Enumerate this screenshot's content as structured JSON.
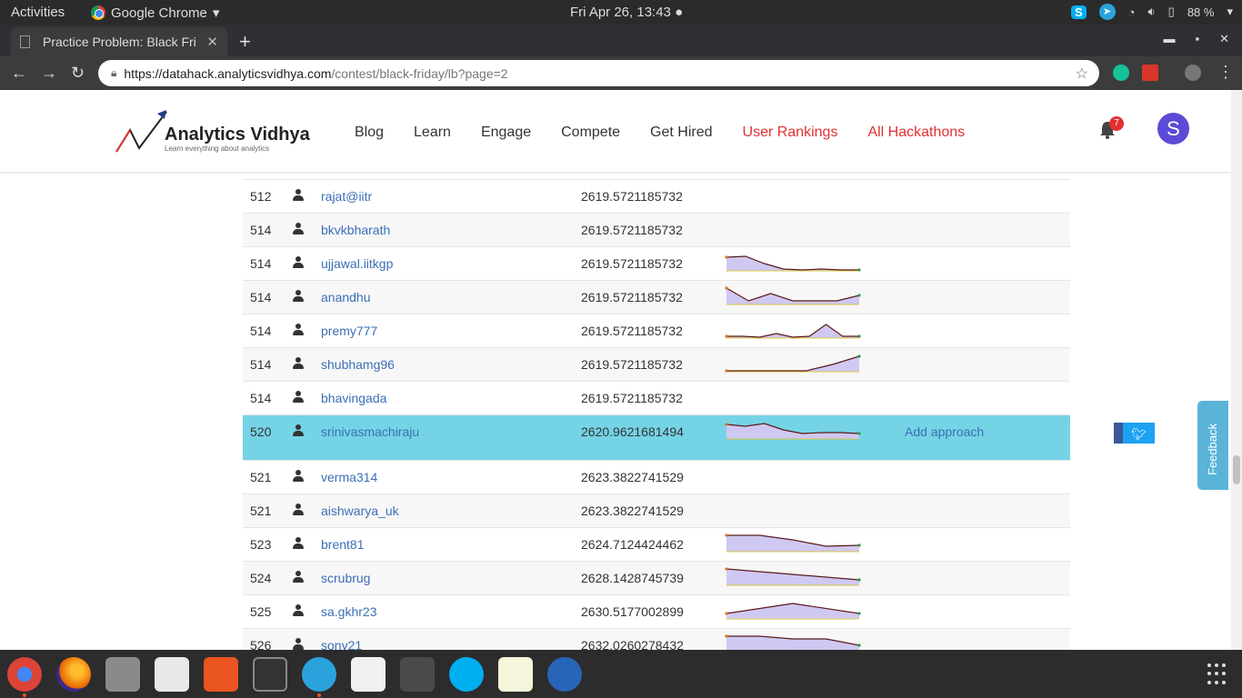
{
  "system": {
    "activities": "Activities",
    "app_name": "Google Chrome",
    "clock": "Fri Apr 26, 13:43",
    "battery": "88 %"
  },
  "browser": {
    "tab_title": "Practice Problem: Black Fri",
    "url_host": "https://datahack.analyticsvidhya.com",
    "url_path": "/contest/black-friday/lb?page=2"
  },
  "site": {
    "brand": "Analytics Vidhya",
    "tagline": "Learn everything about analytics",
    "menu": [
      "Blog",
      "Learn",
      "Engage",
      "Compete",
      "Get Hired",
      "User Rankings",
      "All Hackathons"
    ],
    "notif_count": "7",
    "avatar_letter": "S"
  },
  "leaderboard": {
    "rows": [
      {
        "rank": "512",
        "user": "rajat@iitr",
        "score": "2619.5721185732",
        "spark": null,
        "approach": ""
      },
      {
        "rank": "514",
        "user": "bkvkbharath",
        "score": "2619.5721185732",
        "spark": null,
        "approach": ""
      },
      {
        "rank": "514",
        "user": "ujjawal.iitkgp",
        "score": "2619.5721185732",
        "spark": [
          5,
          4,
          12,
          18,
          19,
          18,
          19,
          19
        ],
        "approach": ""
      },
      {
        "rank": "514",
        "user": "anandhu",
        "score": "2619.5721185732",
        "spark": [
          2,
          16,
          8,
          16,
          16,
          16,
          10
        ],
        "approach": ""
      },
      {
        "rank": "514",
        "user": "premy777",
        "score": "2619.5721185732",
        "spark": [
          18,
          18,
          19,
          15,
          19,
          18,
          5,
          18,
          18
        ],
        "approach": ""
      },
      {
        "rank": "514",
        "user": "shubhamg96",
        "score": "2619.5721185732",
        "spark": [
          19,
          19,
          19,
          19,
          12,
          3
        ],
        "approach": ""
      },
      {
        "rank": "514",
        "user": "bhavingada",
        "score": "2619.5721185732",
        "spark": null,
        "approach": ""
      },
      {
        "rank": "520",
        "user": "srinivasmachiraju",
        "score": "2620.9621681494",
        "spark": [
          4,
          6,
          3,
          10,
          14,
          13,
          13,
          14
        ],
        "approach": "Add approach",
        "highlight": true
      },
      {
        "rank": "521",
        "user": "verma314",
        "score": "2623.3822741529",
        "spark": null,
        "approach": ""
      },
      {
        "rank": "521",
        "user": "aishwarya_uk",
        "score": "2623.3822741529",
        "spark": null,
        "approach": ""
      },
      {
        "rank": "523",
        "user": "brent81",
        "score": "2624.7124424462",
        "spark": [
          2,
          2,
          7,
          14,
          13
        ],
        "approach": ""
      },
      {
        "rank": "524",
        "user": "scrubrug",
        "score": "2628.1428745739",
        "spark": [
          2,
          8,
          14
        ],
        "approach": ""
      },
      {
        "rank": "525",
        "user": "sa.gkhr23",
        "score": "2630.5177002899",
        "spark": [
          14,
          3,
          14
        ],
        "approach": ""
      },
      {
        "rank": "526",
        "user": "sony21",
        "score": "2632.0260278432",
        "spark": [
          2,
          2,
          5,
          5,
          12
        ],
        "approach": ""
      }
    ]
  },
  "widgets": {
    "feedback": "Feedback"
  }
}
